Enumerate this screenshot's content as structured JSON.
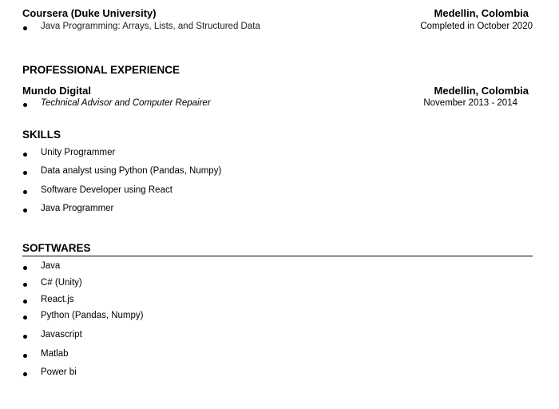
{
  "education": {
    "org": "Coursera (Duke University)",
    "location": "Medellin, Colombia",
    "item": "Java Programming: Arrays, Lists, and Structured Data",
    "date": "Completed in October 2020"
  },
  "experience": {
    "heading": "PROFESSIONAL EXPERIENCE",
    "org": "Mundo Digital",
    "location": "Medellin, Colombia",
    "role": "Technical Advisor and Computer Repairer",
    "dates": "November 2013 - 2014"
  },
  "skills": {
    "heading": "SKILLS",
    "items": [
      "Unity Programmer",
      "Data analyst using Python (Pandas, Numpy)",
      "Software Developer using React",
      "Java Programmer"
    ]
  },
  "softwares": {
    "heading": "SOFTWARES",
    "items": [
      "Java",
      "C# (Unity)",
      "React.js",
      "Python (Pandas, Numpy)",
      "Javascript",
      "Matlab",
      "Power bi"
    ]
  }
}
